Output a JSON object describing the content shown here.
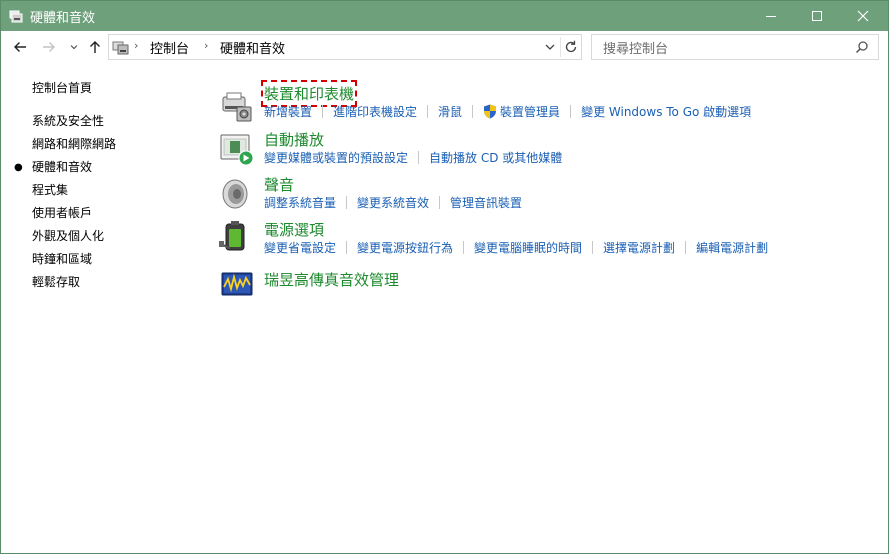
{
  "window": {
    "title": "硬體和音效"
  },
  "controls": {
    "minimize_icon": "minimize-icon",
    "maximize_icon": "maximize-icon",
    "close_icon": "close-icon"
  },
  "address": {
    "crumbs": [
      "控制台",
      "硬體和音效"
    ]
  },
  "search": {
    "placeholder": "搜尋控制台"
  },
  "sidebar": {
    "items": [
      {
        "label": "控制台首頁"
      },
      {
        "label": "系統及安全性"
      },
      {
        "label": "網路和網際網路"
      },
      {
        "label": "硬體和音效",
        "current": true
      },
      {
        "label": "程式集"
      },
      {
        "label": "使用者帳戶"
      },
      {
        "label": "外觀及個人化"
      },
      {
        "label": "時鐘和區域"
      },
      {
        "label": "輕鬆存取"
      }
    ]
  },
  "categories": [
    {
      "title": "裝置和印表機",
      "icon": "printer-icon",
      "links": [
        "新增裝置",
        "進階印表機設定",
        "滑鼠",
        "裝置管理員",
        "變更 Windows To Go 啟動選項"
      ]
    },
    {
      "title": "自動播放",
      "icon": "autoplay-icon",
      "links": [
        "變更媒體或裝置的預設設定",
        "自動播放 CD 或其他媒體"
      ]
    },
    {
      "title": "聲音",
      "icon": "speaker-icon",
      "links": [
        "調整系統音量",
        "變更系統音效",
        "管理音訊裝置"
      ]
    },
    {
      "title": "電源選項",
      "icon": "battery-icon",
      "links": [
        "變更省電設定",
        "變更電源按鈕行為",
        "變更電腦睡眠的時間",
        "選擇電源計劃",
        "編輯電源計劃"
      ]
    },
    {
      "title": "瑞昱高傳真音效管理",
      "icon": "realtek-audio-icon",
      "links": []
    }
  ],
  "colors": {
    "titlebar": "#6ea07c",
    "category_title": "#1e8a2e",
    "link": "#1a5fb4",
    "focus_outline": "#d40000"
  }
}
